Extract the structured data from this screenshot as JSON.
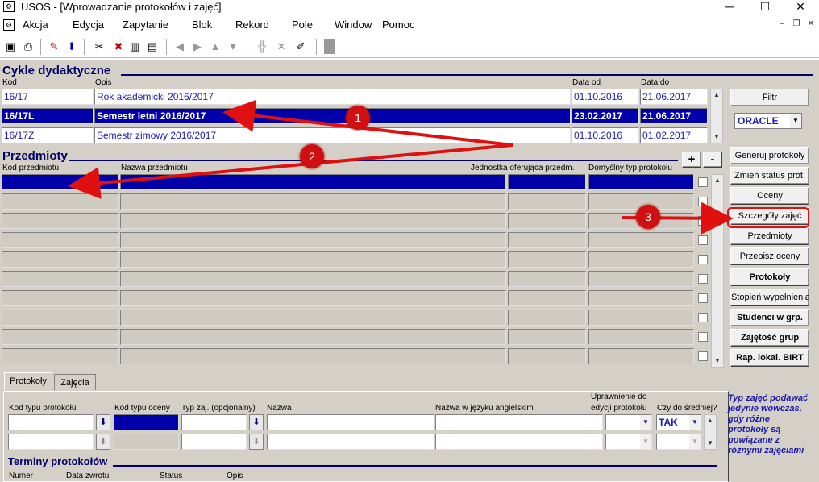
{
  "window": {
    "title": "USOS - [Wprowadzanie protokołów i zajęć]",
    "app_icon": "usos-app-icon",
    "controls": [
      "minimize-icon",
      "restore-icon",
      "close-icon"
    ]
  },
  "menu": {
    "items": [
      "Akcja",
      "Edycja",
      "Zapytanie",
      "Blok",
      "Rekord",
      "Pole",
      "Window",
      "Pomoc"
    ]
  },
  "cycles": {
    "title": "Cykle dydaktyczne",
    "headers": {
      "code": "Kod",
      "desc": "Opis",
      "from": "Data od",
      "to": "Data do"
    },
    "rows": [
      {
        "code": "16/17",
        "desc": "Rok akademicki 2016/2017",
        "from": "01.10.2016",
        "to": "21.06.2017"
      },
      {
        "code": "16/17L",
        "desc": "Semestr letni 2016/2017",
        "from": "23.02.2017",
        "to": "21.06.2017"
      },
      {
        "code": "16/17Z",
        "desc": "Semestr zimowy 2016/2017",
        "from": "01.10.2016",
        "to": "01.02.2017"
      }
    ]
  },
  "filter": {
    "button": "Filtr",
    "select_value": "ORACLE"
  },
  "subjects": {
    "title": "Przedmioty",
    "headers": {
      "code": "Kod przedmiotu",
      "name": "Nazwa przedmiotu",
      "unit": "Jednostka oferująca przedm.",
      "type": "Domyślny typ protokołu"
    },
    "plus": "+",
    "minus": "-"
  },
  "side_buttons": [
    "Generuj protokoły",
    "Zmień status prot.",
    "Oceny",
    "Szczegóły zajęć",
    "Przedmioty",
    "Przepisz oceny",
    "Protokoły",
    "Stopień wypełnienia",
    "Studenci w grp.",
    "Zajętość grup",
    "Rap. lokal. BIRT"
  ],
  "tabs": [
    "Protokoły",
    "Zajęcia"
  ],
  "protocols": {
    "headers": {
      "type_code": "Kod typu protokołu",
      "grade_type": "Kod typu oceny",
      "class_type": "Typ zaj. (opcjonalny)",
      "name": "Nazwa",
      "name_en": "Nazwa w języku angielskim",
      "edit_rights_1": "Uprawnienie do",
      "edit_rights_2": "edycji protokołu",
      "avg": "Czy do średniej?"
    },
    "avg_value": "TAK",
    "hint": "Typ zajęć podawać jedynie wówczas, gdy różne protokoły są powiązane z różnymi zajęciami"
  },
  "terms": {
    "title": "Terminy protokołów",
    "headers": {
      "num": "Numer",
      "date": "Data zwrotu",
      "status": "Status",
      "desc": "Opis"
    }
  },
  "callouts": [
    "1",
    "2",
    "3"
  ],
  "colors": {
    "selection": "#0000aa",
    "form_bg": "#d4d0c8",
    "section_title": "#000066",
    "callout": "#d01010"
  }
}
